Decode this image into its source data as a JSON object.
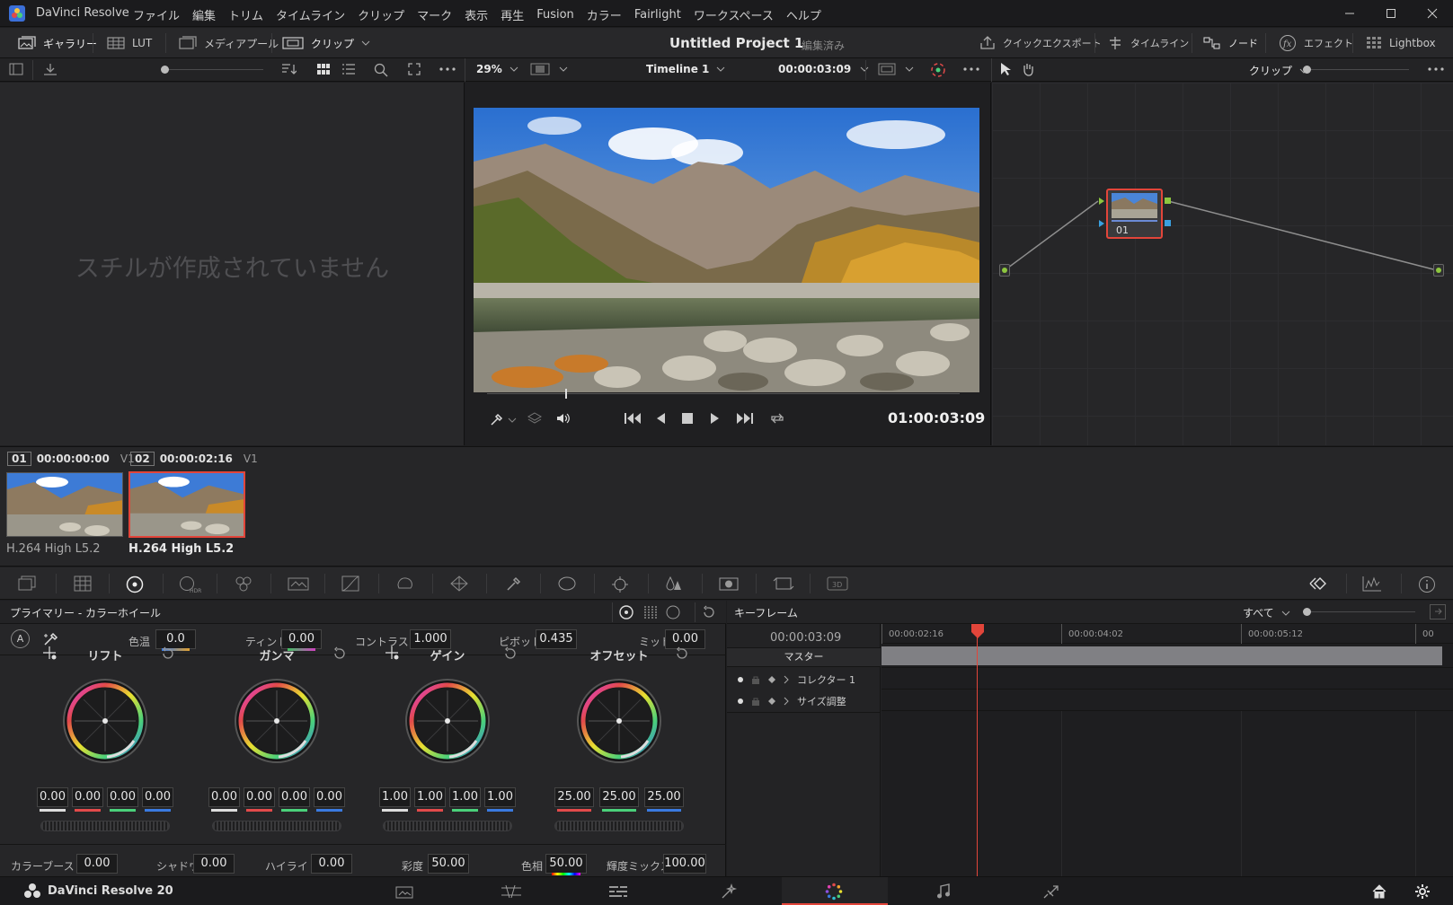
{
  "app": {
    "title": "DaVinci Resolve"
  },
  "menu": [
    "ファイル",
    "編集",
    "トリム",
    "タイムライン",
    "クリップ",
    "マーク",
    "表示",
    "再生",
    "Fusion",
    "カラー",
    "Fairlight",
    "ワークスペース",
    "ヘルプ"
  ],
  "toolbar": {
    "gallery": "ギャラリー",
    "lut": "LUT",
    "media_pool": "メディアプール",
    "clip": "クリップ",
    "project_title": "Untitled Project 1",
    "project_status": "編集済み",
    "quick_export": "クイックエクスポート",
    "timeline": "タイムライン",
    "nodes": "ノード",
    "effects": "エフェクト",
    "lightbox": "Lightbox"
  },
  "subtoolbar": {
    "zoom": "29%",
    "timeline_name": "Timeline 1",
    "timecode": "00:00:03:09",
    "node_mode": "クリップ"
  },
  "gallery": {
    "empty_message": "スチルが作成されていません"
  },
  "viewer": {
    "timecode": "01:00:03:09",
    "scrub_position": 0.165
  },
  "node_graph": {
    "node_label": "01"
  },
  "clips": [
    {
      "number": "01",
      "timecode": "00:00:00:00",
      "track": "V1",
      "codec": "H.264 High L5.2",
      "selected": false
    },
    {
      "number": "02",
      "timecode": "00:00:02:16",
      "track": "V1",
      "codec": "H.264 High L5.2",
      "selected": true
    }
  ],
  "primaries": {
    "title": "プライマリー - カラーホイール",
    "auto": "A",
    "params_top": [
      {
        "label": "色温",
        "value": "0.0"
      },
      {
        "label": "ティント",
        "value": "0.00"
      },
      {
        "label": "コントラスト",
        "value": "1.000"
      },
      {
        "label": "ピボット",
        "value": "0.435"
      },
      {
        "label": "ミッド",
        "value": "0.00"
      }
    ],
    "wheels": [
      {
        "name": "リフト",
        "values": [
          "0.00",
          "0.00",
          "0.00",
          "0.00"
        ]
      },
      {
        "name": "ガンマ",
        "values": [
          "0.00",
          "0.00",
          "0.00",
          "0.00"
        ]
      },
      {
        "name": "ゲイン",
        "values": [
          "1.00",
          "1.00",
          "1.00",
          "1.00"
        ]
      },
      {
        "name": "オフセット",
        "values": [
          "25.00",
          "25.00",
          "25.00"
        ]
      }
    ],
    "params_bottom": [
      {
        "label": "カラーブースト",
        "value": "0.00"
      },
      {
        "label": "シャドウ",
        "value": "0.00"
      },
      {
        "label": "ハイライト",
        "value": "0.00"
      },
      {
        "label": "彩度",
        "value": "50.00"
      },
      {
        "label": "色相",
        "value": "50.00"
      },
      {
        "label": "輝度ミックス",
        "value": "100.00"
      }
    ]
  },
  "keyframes": {
    "title": "キーフレーム",
    "filter": "すべて",
    "current_timecode": "00:00:03:09",
    "ruler": [
      "00:00:02:16",
      "00:00:04:02",
      "00:00:05:12",
      "00"
    ],
    "master": "マスター",
    "tracks": [
      "コレクター 1",
      "サイズ調整"
    ]
  },
  "bottom": {
    "brand": "DaVinci Resolve 20"
  },
  "colors": {
    "accent_red": "#e2453a",
    "selected_page": "#e2453a"
  }
}
